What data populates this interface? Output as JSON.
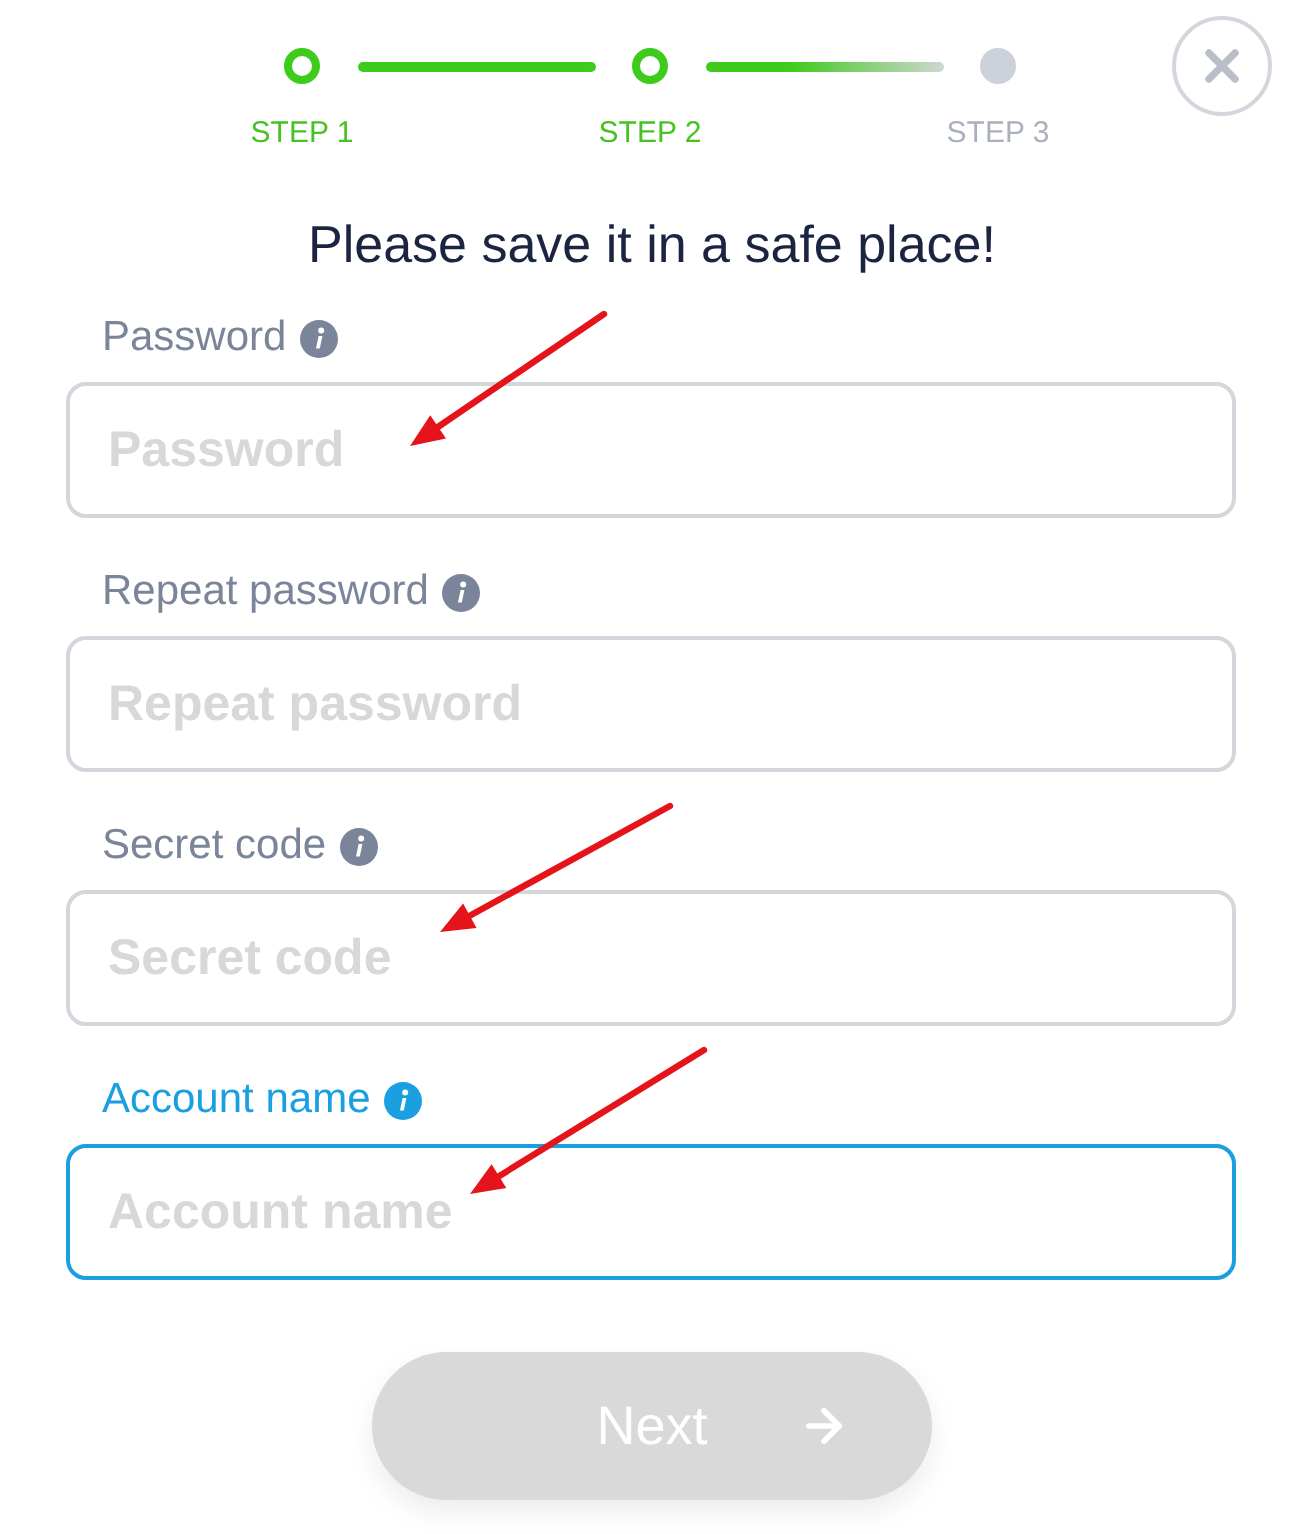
{
  "stepper": {
    "steps": [
      {
        "label": "STEP 1",
        "active": true
      },
      {
        "label": "STEP 2",
        "active": true
      },
      {
        "label": "STEP 3",
        "active": false
      }
    ]
  },
  "heading": "Please save it in a safe place!",
  "fields": [
    {
      "label": "Password",
      "placeholder": "Password",
      "focused": false,
      "arrow": true
    },
    {
      "label": "Repeat password",
      "placeholder": "Repeat password",
      "focused": false,
      "arrow": false
    },
    {
      "label": "Secret code",
      "placeholder": "Secret code",
      "focused": false,
      "arrow": true
    },
    {
      "label": "Account name",
      "placeholder": "Account name",
      "focused": true,
      "arrow": true
    }
  ],
  "next_button": {
    "label": "Next",
    "disabled": true
  }
}
